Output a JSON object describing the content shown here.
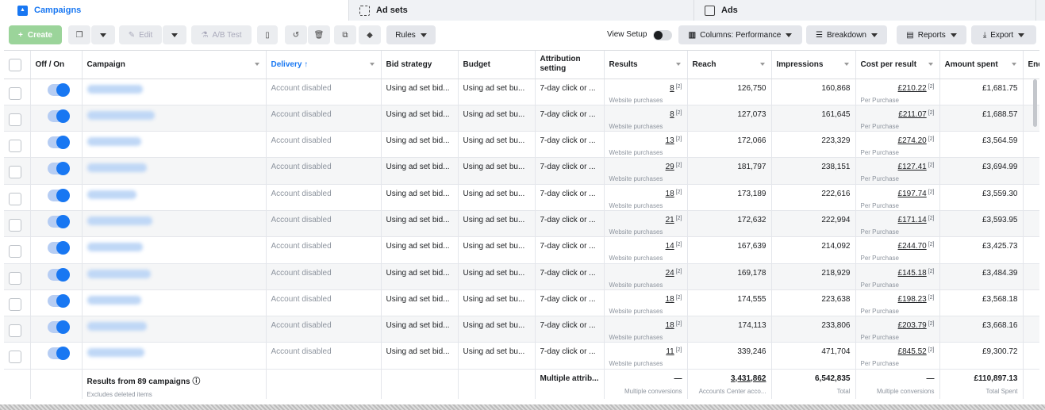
{
  "tabs": [
    {
      "label": "Campaigns",
      "icon": "campaign-icon"
    },
    {
      "label": "Ad sets",
      "icon": "adsets-grid-icon"
    },
    {
      "label": "Ads",
      "icon": "ads-window-icon"
    }
  ],
  "toolbar": {
    "create": "Create",
    "edit": "Edit",
    "ab_test": "A/B Test",
    "rules": "Rules",
    "view_setup": "View Setup",
    "columns": "Columns: Performance",
    "breakdown": "Breakdown",
    "reports": "Reports",
    "export": "Export"
  },
  "columns": [
    "Off / On",
    "Campaign",
    "Delivery",
    "Bid strategy",
    "Budget",
    "Attribution setting",
    "Results",
    "Reach",
    "Impressions",
    "Cost per result",
    "Amount spent",
    "End"
  ],
  "rows": [
    {
      "delivery": "Account disabled",
      "bid": "Using ad set bid...",
      "budget": "Using ad set bu...",
      "attribution": "7-day click or ...",
      "results": "8",
      "results_sub": "Website purchases",
      "reach": "126,750",
      "impressions": "160,868",
      "cpr": "£210.22",
      "cpr_sub": "Per Purchase",
      "spent": "£1,681.75"
    },
    {
      "delivery": "Account disabled",
      "bid": "Using ad set bid...",
      "budget": "Using ad set bu...",
      "attribution": "7-day click or ...",
      "results": "8",
      "results_sub": "Website purchases",
      "reach": "127,073",
      "impressions": "161,645",
      "cpr": "£211.07",
      "cpr_sub": "Per Purchase",
      "spent": "£1,688.57"
    },
    {
      "delivery": "Account disabled",
      "bid": "Using ad set bid...",
      "budget": "Using ad set bu...",
      "attribution": "7-day click or ...",
      "results": "13",
      "results_sub": "Website purchases",
      "reach": "172,066",
      "impressions": "223,329",
      "cpr": "£274.20",
      "cpr_sub": "Per Purchase",
      "spent": "£3,564.59"
    },
    {
      "delivery": "Account disabled",
      "bid": "Using ad set bid...",
      "budget": "Using ad set bu...",
      "attribution": "7-day click or ...",
      "results": "29",
      "results_sub": "Website purchases",
      "reach": "181,797",
      "impressions": "238,151",
      "cpr": "£127.41",
      "cpr_sub": "Per Purchase",
      "spent": "£3,694.99"
    },
    {
      "delivery": "Account disabled",
      "bid": "Using ad set bid...",
      "budget": "Using ad set bu...",
      "attribution": "7-day click or ...",
      "results": "18",
      "results_sub": "Website purchases",
      "reach": "173,189",
      "impressions": "222,616",
      "cpr": "£197.74",
      "cpr_sub": "Per Purchase",
      "spent": "£3,559.30"
    },
    {
      "delivery": "Account disabled",
      "bid": "Using ad set bid...",
      "budget": "Using ad set bu...",
      "attribution": "7-day click or ...",
      "results": "21",
      "results_sub": "Website purchases",
      "reach": "172,632",
      "impressions": "222,994",
      "cpr": "£171.14",
      "cpr_sub": "Per Purchase",
      "spent": "£3,593.95"
    },
    {
      "delivery": "Account disabled",
      "bid": "Using ad set bid...",
      "budget": "Using ad set bu...",
      "attribution": "7-day click or ...",
      "results": "14",
      "results_sub": "Website purchases",
      "reach": "167,639",
      "impressions": "214,092",
      "cpr": "£244.70",
      "cpr_sub": "Per Purchase",
      "spent": "£3,425.73"
    },
    {
      "delivery": "Account disabled",
      "bid": "Using ad set bid...",
      "budget": "Using ad set bu...",
      "attribution": "7-day click or ...",
      "results": "24",
      "results_sub": "Website purchases",
      "reach": "169,178",
      "impressions": "218,929",
      "cpr": "£145.18",
      "cpr_sub": "Per Purchase",
      "spent": "£3,484.39"
    },
    {
      "delivery": "Account disabled",
      "bid": "Using ad set bid...",
      "budget": "Using ad set bu...",
      "attribution": "7-day click or ...",
      "results": "18",
      "results_sub": "Website purchases",
      "reach": "174,555",
      "impressions": "223,638",
      "cpr": "£198.23",
      "cpr_sub": "Per Purchase",
      "spent": "£3,568.18"
    },
    {
      "delivery": "Account disabled",
      "bid": "Using ad set bid...",
      "budget": "Using ad set bu...",
      "attribution": "7-day click or ...",
      "results": "18",
      "results_sub": "Website purchases",
      "reach": "174,113",
      "impressions": "233,806",
      "cpr": "£203.79",
      "cpr_sub": "Per Purchase",
      "spent": "£3,668.16"
    },
    {
      "delivery": "Account disabled",
      "bid": "Using ad set bid...",
      "budget": "Using ad set bu...",
      "attribution": "7-day click or ...",
      "results": "11",
      "results_sub": "Website purchases",
      "reach": "339,246",
      "impressions": "471,704",
      "cpr": "£845.52",
      "cpr_sub": "Per Purchase",
      "spent": "£9,300.72"
    }
  ],
  "totals": {
    "label": "Results from 89 campaigns",
    "label_sub": "Excludes deleted items",
    "attribution": "Multiple attrib...",
    "results": "—",
    "results_sub": "Multiple conversions",
    "reach": "3,431,862",
    "reach_sub": "Accounts Center acco...",
    "impressions": "6,542,835",
    "impressions_sub": "Total",
    "cpr": "—",
    "cpr_sub": "Multiple conversions",
    "spent": "£110,897.13",
    "spent_sub": "Total Spent"
  },
  "footnote_marker": "[2]",
  "colors": {
    "accent": "#1877f2",
    "create": "#9bd49a"
  }
}
